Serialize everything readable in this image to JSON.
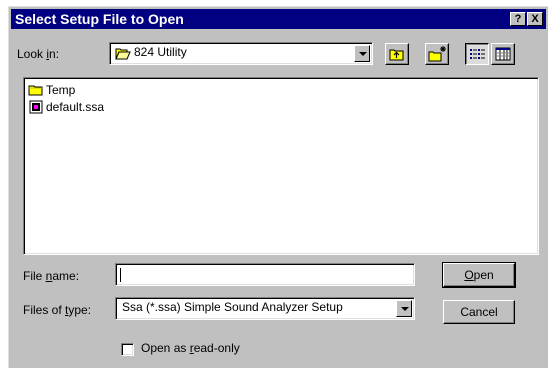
{
  "window": {
    "title": "Select Setup File to Open",
    "help_glyph": "?",
    "close_glyph": "X"
  },
  "look_in": {
    "label_pre": "Look ",
    "label_key": "i",
    "label_post": "n:",
    "value": "824 Utility",
    "icon": "folder-open-icon"
  },
  "toolbar": {
    "up_one_level_icon": "up-folder-icon",
    "new_folder_icon": "new-folder-icon",
    "list_view_icon": "list-view-icon",
    "details_view_icon": "details-view-icon"
  },
  "files": [
    {
      "name": "Temp",
      "icon": "folder-icon"
    },
    {
      "name": "default.ssa",
      "icon": "ssa-file-icon"
    }
  ],
  "file_name": {
    "label_pre": "File ",
    "label_key": "n",
    "label_post": "ame:",
    "value": ""
  },
  "file_type": {
    "label_pre": "Files of ",
    "label_key": "t",
    "label_post": "ype:",
    "value": "Ssa (*.ssa) Simple Sound Analyzer Setup"
  },
  "buttons": {
    "open_key": "O",
    "open_rest": "pen",
    "cancel": "Cancel"
  },
  "read_only": {
    "label_pre": "Open as ",
    "label_key": "r",
    "label_post": "ead-only",
    "checked": false
  },
  "colors": {
    "title_bar": "#000080",
    "face": "#c0c0c0",
    "folder": "#ffff00"
  }
}
